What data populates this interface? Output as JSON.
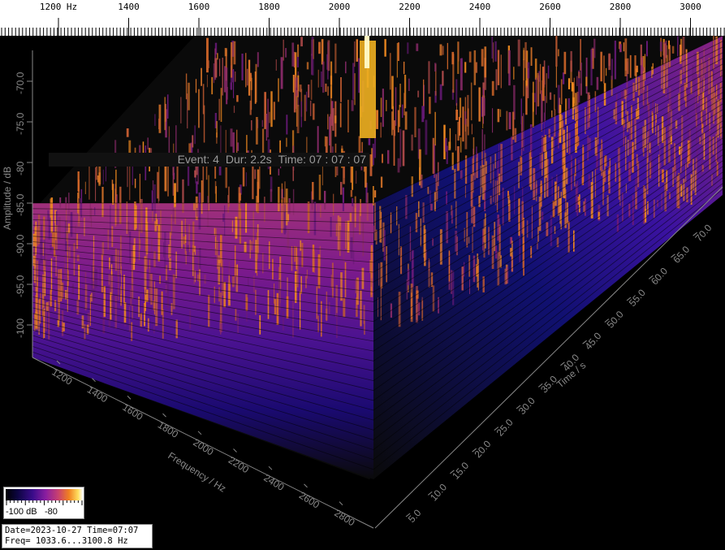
{
  "top_axis": {
    "unit": "Hz",
    "labels": [
      "1200",
      "1400",
      "1600",
      "1800",
      "2000",
      "2200",
      "2400",
      "2600",
      "2800",
      "3000"
    ]
  },
  "amplitude_axis": {
    "label": "Amplitude / dB",
    "ticks": [
      "-70.0",
      "-75.0",
      "-80",
      "-85.0",
      "-90.0",
      "-95.0",
      "-100"
    ]
  },
  "frequency_axis": {
    "label": "Frequency / Hz",
    "ticks": [
      "1200",
      "1400",
      "1600",
      "1800",
      "2000",
      "2200",
      "2400",
      "2600",
      "2800"
    ]
  },
  "time_axis": {
    "label": "Time / s",
    "ticks": [
      "5.0",
      "10.0",
      "15.0",
      "20.0",
      "25.0",
      "30.0",
      "35.0",
      "40.0",
      "45.0",
      "50.0",
      "55.0",
      "60.0",
      "65.0",
      "70.0"
    ]
  },
  "event_banner": {
    "event": "Event: 4",
    "duration": "Dur: 2.2s",
    "time": "Time: 07 : 07 : 07"
  },
  "colorbar": {
    "low_label": "-100 dB",
    "high_label": "-80"
  },
  "info": {
    "line1": "Date=2023-10-27 Time=07:07",
    "line2": "Freq= 1033.6...3100.8 Hz"
  },
  "colors": {
    "background": "#000000",
    "spectrum_peak": "#f08a20",
    "spectrum_mid": "#9a2a7a",
    "spectrum_floor": "#1a0a8a",
    "event_line": "#ffe040"
  }
}
